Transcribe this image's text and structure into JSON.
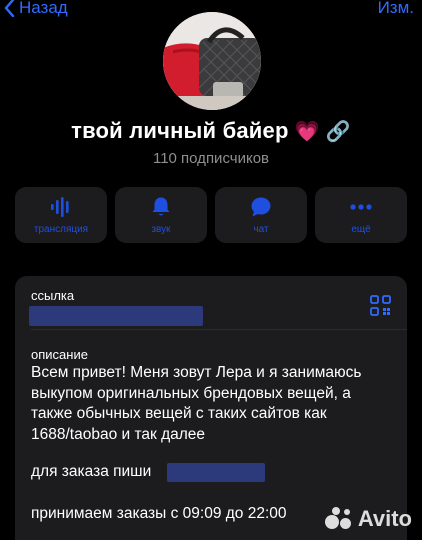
{
  "nav": {
    "back_label": "Назад",
    "edit_label": "Изм."
  },
  "channel": {
    "title": "твой личный байер",
    "title_emojis": "💗 🔗",
    "subscribers": "110 подписчиков"
  },
  "actions": [
    {
      "label": "трансляция",
      "icon": "broadcast-icon"
    },
    {
      "label": "звук",
      "icon": "bell-icon"
    },
    {
      "label": "чат",
      "icon": "chat-bubble-icon"
    },
    {
      "label": "ещё",
      "icon": "more-dots-icon"
    }
  ],
  "info": {
    "link_label": "ссылка",
    "description_label": "описание",
    "description_text": "Всем привет! Меня зовут Лера и я занимаюсь выкупом оригинальных брендовых вещей, а также обычных вещей с таких сайтов как 1688/taobao и так далее",
    "order_text": "для заказа пиши",
    "hours_text": "принимаем заказы с 09:09 до 22:00"
  },
  "watermark": "Avito",
  "colors": {
    "accent": "#2f6bff",
    "card_bg": "#1c1c1e",
    "secondary_text": "#8e8e93",
    "masked_bar": "#2c3a7c"
  }
}
